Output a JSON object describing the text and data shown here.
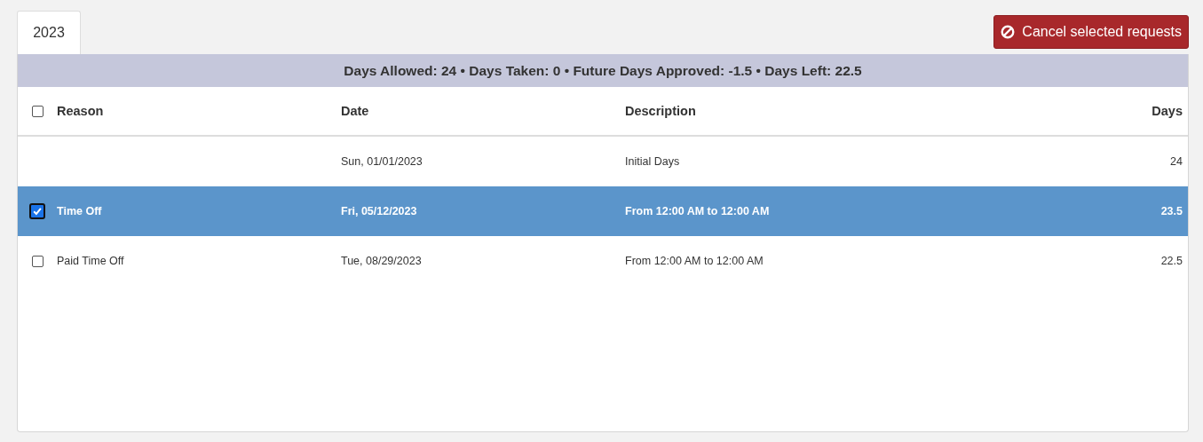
{
  "tabs": [
    {
      "label": "2023",
      "selected": true
    }
  ],
  "cancel_button": {
    "label": "Cancel selected requests"
  },
  "summary": "Days Allowed: 24 • Days Taken: 0 • Future Days Approved: -1.5 • Days Left: 22.5",
  "table": {
    "select_all_checked": false,
    "columns": [
      "Reason",
      "Date",
      "Description",
      "Days"
    ],
    "rows": [
      {
        "kind": "balance",
        "reason": "",
        "date": "Sun, 01/01/2023",
        "description": "Initial Days",
        "days": "24",
        "selected": false
      },
      {
        "kind": "request",
        "reason": "Time Off",
        "date": "Fri, 05/12/2023",
        "description": "From 12:00 AM to 12:00 AM",
        "days": "23.5",
        "selected": true,
        "checked": true
      },
      {
        "kind": "request",
        "reason": "Paid Time Off",
        "date": "Tue, 08/29/2023",
        "description": "From 12:00 AM to 12:00 AM",
        "days": "22.5",
        "selected": false,
        "checked": false
      }
    ]
  }
}
